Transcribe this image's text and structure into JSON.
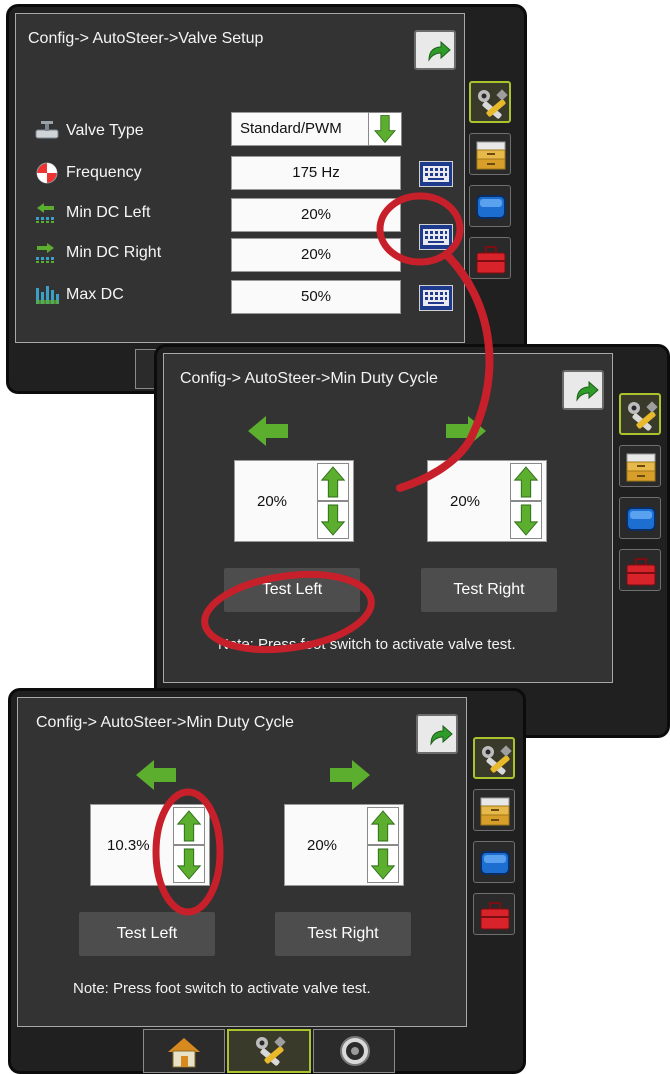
{
  "screens": [
    {
      "title": "Config-> AutoSteer->Valve Setup",
      "rows": [
        {
          "label": "Valve Type",
          "value": "Standard/PWM",
          "icon": "valve-icon"
        },
        {
          "label": "Frequency",
          "value": "175 Hz",
          "icon": "frequency-icon"
        },
        {
          "label": "Min DC Left",
          "value": "20%",
          "icon": "min-dc-left-icon"
        },
        {
          "label": "Min DC Right",
          "value": "20%",
          "icon": "min-dc-right-icon"
        },
        {
          "label": "Max DC",
          "value": "50%",
          "icon": "max-dc-icon"
        }
      ]
    },
    {
      "title": "Config-> AutoSteer->Min Duty Cycle",
      "left_value": "20%",
      "right_value": "20%",
      "test_left": "Test Left",
      "test_right": "Test Right",
      "note": "Note: Press foot switch to activate valve test."
    },
    {
      "title": "Config-> AutoSteer->Min Duty Cycle",
      "left_value": "10.3%",
      "right_value": "20%",
      "test_left": "Test Left",
      "test_right": "Test Right",
      "note": "Note: Press foot switch to activate valve test."
    }
  ],
  "side_tabs": [
    "tools-icon",
    "bins-icon",
    "monitor-icon",
    "toolbox-icon"
  ],
  "bottom_tabs": [
    "home-icon",
    "tools-icon",
    "gauge-icon"
  ],
  "colors": {
    "accent_green": "#5cae2e",
    "highlight_red": "#c8202a",
    "active_border": "#a9c42c"
  }
}
